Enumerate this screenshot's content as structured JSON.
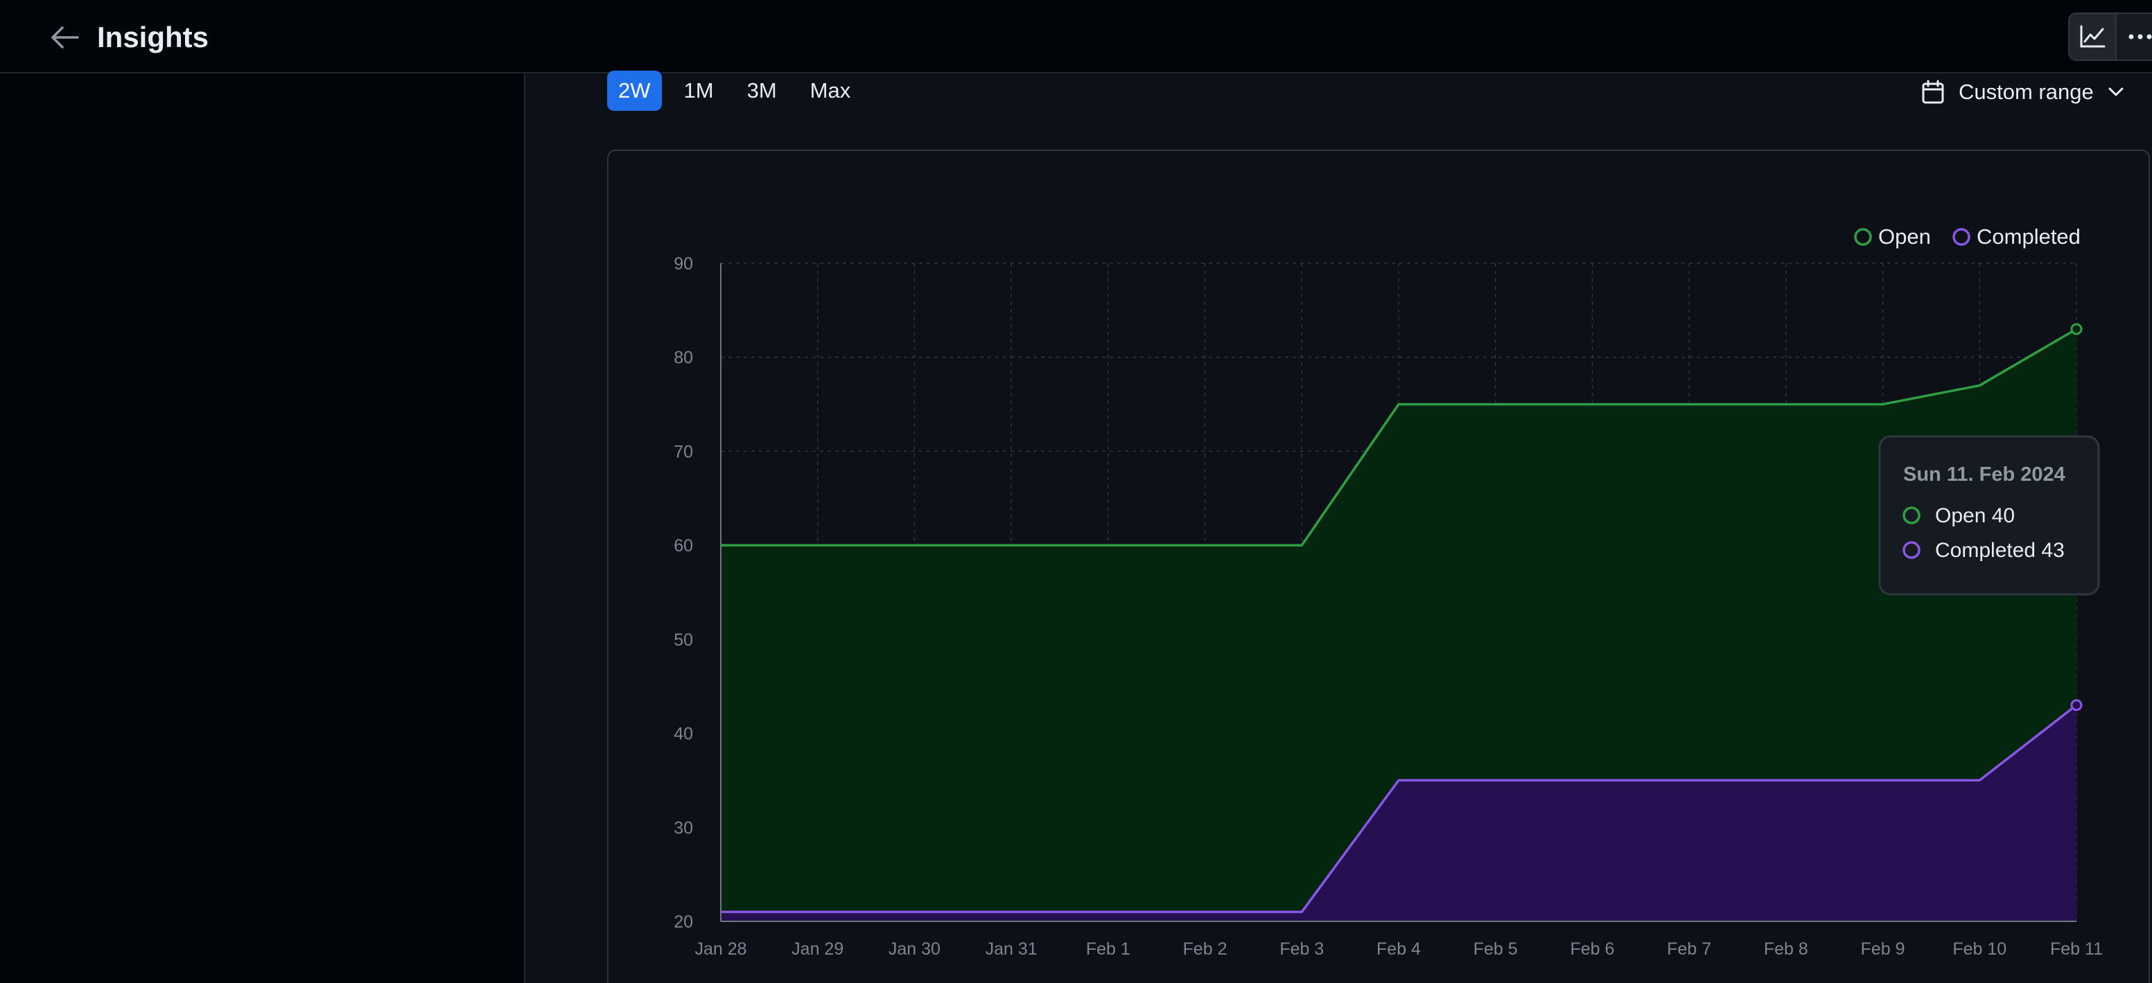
{
  "header": {
    "title": "Insights",
    "back_icon": "arrow-left-icon",
    "tool_icons": [
      "line-chart-icon",
      "kebab-horizontal-icon"
    ]
  },
  "range_tabs": [
    {
      "label": "2W",
      "active": true
    },
    {
      "label": "1M",
      "active": false
    },
    {
      "label": "3M",
      "active": false
    },
    {
      "label": "Max",
      "active": false
    }
  ],
  "custom_range": {
    "label": "Custom range",
    "icon": "calendar-icon",
    "chevron": "chevron-down-icon"
  },
  "colors": {
    "open": "#2ea043",
    "open_fill": "#04260f",
    "completed": "#8957e5",
    "completed_fill": "#271052",
    "accent": "#1f6feb"
  },
  "chart_data": {
    "type": "area",
    "categories": [
      "Jan 28",
      "Jan 29",
      "Jan 30",
      "Jan 31",
      "Feb 1",
      "Feb 2",
      "Feb 3",
      "Feb 4",
      "Feb 5",
      "Feb 6",
      "Feb 7",
      "Feb 8",
      "Feb 9",
      "Feb 10",
      "Feb 11"
    ],
    "series": [
      {
        "name": "Open",
        "values": [
          60,
          60,
          60,
          60,
          60,
          60,
          60,
          75,
          75,
          75,
          75,
          75,
          75,
          77,
          83
        ]
      },
      {
        "name": "Completed",
        "values": [
          21,
          21,
          21,
          21,
          21,
          21,
          21,
          35,
          35,
          35,
          35,
          35,
          35,
          35,
          43
        ]
      }
    ],
    "ylim": [
      20,
      90
    ],
    "yticks": [
      20,
      30,
      40,
      50,
      60,
      70,
      80,
      90
    ],
    "grid": true,
    "legend": "top-right",
    "tooltip": {
      "title": "Sun 11. Feb 2024",
      "rows": [
        {
          "name": "Open",
          "value": "40"
        },
        {
          "name": "Completed",
          "value": "43"
        }
      ]
    }
  }
}
